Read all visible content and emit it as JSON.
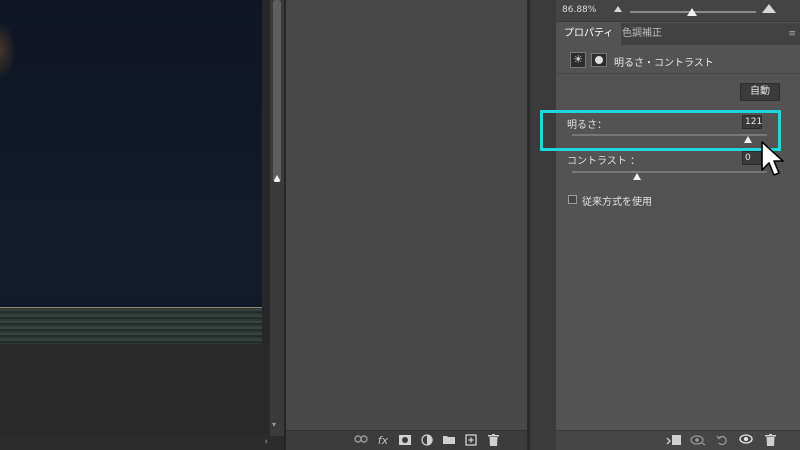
{
  "canvas": {
    "scroll_right_arrow": "›"
  },
  "mid_panel": {
    "footer_icons": [
      "link-icon",
      "fx-icon",
      "mask-icon",
      "adjustment-icon",
      "folder-icon",
      "new-layer-icon",
      "trash-icon"
    ],
    "fx_label": "fx"
  },
  "zoom": {
    "value": "86.88%"
  },
  "properties": {
    "tabs": [
      "プロパティ",
      "色調補正"
    ],
    "adjustment_title": "明るさ・コントラスト",
    "auto_label": "自動",
    "brightness": {
      "label": "明るさ：",
      "value": "121",
      "level": 121,
      "min": -150,
      "max": 150
    },
    "contrast": {
      "label": "コントラスト ：",
      "value": "0",
      "level": 0,
      "min": -50,
      "max": 100
    },
    "legacy_label": "従来方式を使用",
    "footer_icons": [
      "clip-to-layer-icon",
      "view-previous-icon",
      "reset-icon",
      "visibility-icon",
      "trash-icon"
    ]
  },
  "colors": {
    "highlight": "#1fd5e0"
  }
}
